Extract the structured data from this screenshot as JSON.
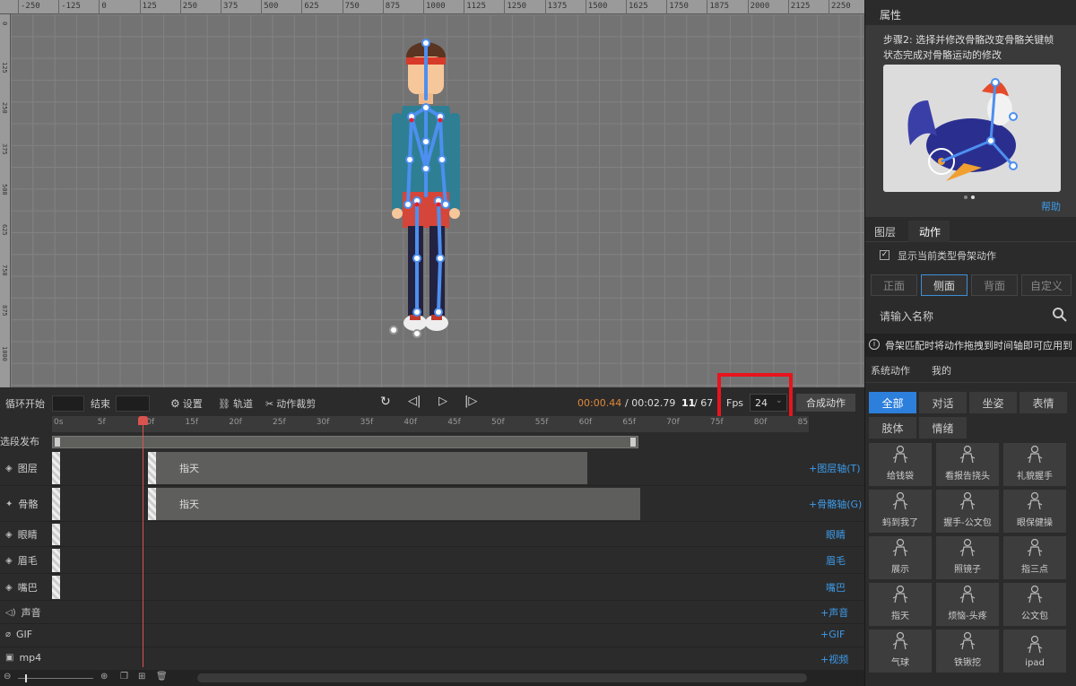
{
  "ruler_top": [
    "-250",
    "-125",
    "0",
    "125",
    "250",
    "375",
    "500",
    "625",
    "750",
    "875",
    "1000",
    "1125",
    "1250",
    "1375",
    "1500",
    "1625",
    "1750",
    "1875",
    "2000",
    "2125",
    "2250"
  ],
  "ruler_left": [
    "0",
    "125",
    "250",
    "375",
    "500",
    "625",
    "750",
    "875",
    "1000",
    "1125"
  ],
  "props": {
    "title": "属性",
    "step_line1": "步骤2: 选择并修改骨骼改变骨骼关键帧",
    "step_line2": "状态完成对骨骼运动的修改",
    "help": "帮助"
  },
  "panel_tabs": [
    "图层",
    "动作"
  ],
  "show_skeleton": "显示当前类型骨架动作",
  "view_tabs": [
    "正面",
    "侧面",
    "背面",
    "自定义"
  ],
  "search": {
    "placeholder": "请输入名称"
  },
  "info": "骨架匹配时将动作拖拽到时间轴即可应用到",
  "action_tabs": [
    "系统动作",
    "我的"
  ],
  "categories": [
    "全部",
    "对话",
    "坐姿",
    "表情",
    "肢体",
    "情绪"
  ],
  "actions": [
    "给钱袋",
    "看报告挠头",
    "礼貌握手",
    "蚂到我了",
    "握手-公文包",
    "眼保健操",
    "展示",
    "照镜子",
    "指三点",
    "指天",
    "烦恼-头疼",
    "公文包",
    "气球",
    "铁锹挖",
    "ipad"
  ],
  "toolbar": {
    "loop_start": "循环开始",
    "end": "结束",
    "settings": "设置",
    "track": "轨道",
    "cut": "动作裁剪",
    "time_current": "00:00.44",
    "time_total": "/ 00:02.79",
    "frame": "11",
    "frame_total": "/ 67",
    "fps_label": "Fps",
    "fps_value": "24",
    "compose": "合成动作"
  },
  "frame_ticks": [
    "0s",
    "5f",
    "10f",
    "15f",
    "20f",
    "25f",
    "30f",
    "35f",
    "40f",
    "45f",
    "50f",
    "55f",
    "60f",
    "65f",
    "70f",
    "75f",
    "80f",
    "85"
  ],
  "segment_label": "选段发布",
  "tracks": [
    {
      "name": "图层",
      "clip": "指天",
      "button": "+图层轴(T)"
    },
    {
      "name": "骨骼",
      "clip": "指天",
      "button": "+骨骼轴(G)"
    },
    {
      "name": "眼睛",
      "button": "眼睛"
    },
    {
      "name": "眉毛",
      "button": "眉毛"
    },
    {
      "name": "嘴巴",
      "button": "嘴巴"
    },
    {
      "name": "声音",
      "button": "+声音"
    },
    {
      "name": "GIF",
      "button": "+GIF"
    },
    {
      "name": "mp4",
      "button": "+视频"
    }
  ],
  "colors": {
    "accent": "#2d7fdc",
    "highlight": "#e8141c",
    "playhead": "#d9534f",
    "time": "#e0873a"
  }
}
